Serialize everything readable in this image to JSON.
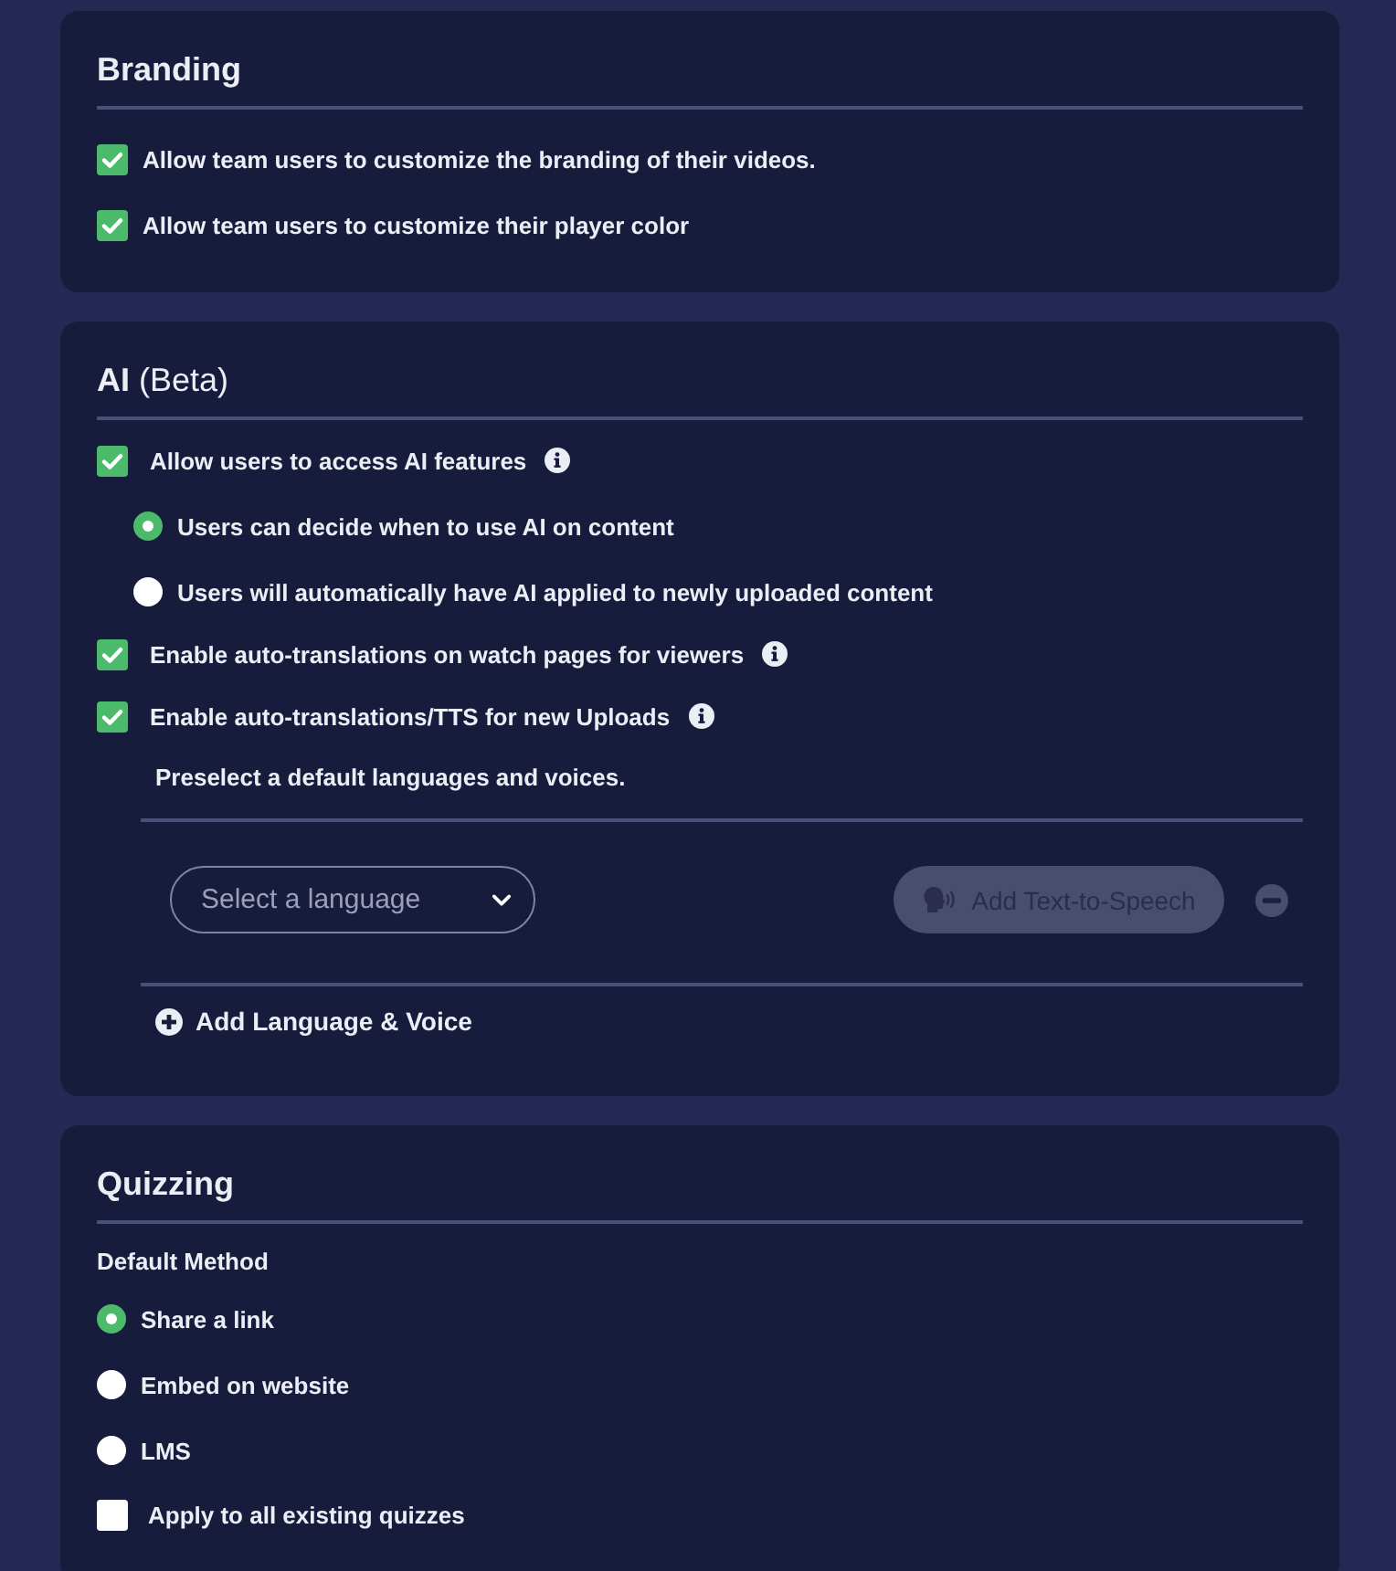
{
  "sections": [
    {
      "kind": "branding",
      "title": "Branding",
      "items": [
        {
          "kind": "checkbox",
          "label": "Allow team users to customize the branding of their videos.",
          "checked": true,
          "info": false
        },
        {
          "kind": "checkbox",
          "label": "Allow team users to customize their player color",
          "checked": true,
          "info": false
        }
      ]
    },
    {
      "kind": "ai",
      "title": "AI",
      "title_note": "(Beta)",
      "items": [
        {
          "kind": "checkbox",
          "label": "Allow users to access AI features",
          "checked": true,
          "info": true,
          "options": [
            {
              "label": "Users can decide when to use AI on content",
              "selected": true
            },
            {
              "label": "Users will automatically have AI applied to newly uploaded content",
              "selected": false
            }
          ]
        },
        {
          "kind": "checkbox",
          "label": "Enable auto-translations on watch pages for viewers",
          "checked": true,
          "info": true
        },
        {
          "kind": "checkbox",
          "label": "Enable auto-translations/TTS for new Uploads",
          "checked": true,
          "info": true
        },
        {
          "kind": "note",
          "label": "Preselect a default languages and voices."
        },
        {
          "kind": "language_row",
          "select": {
            "placeholder": "Select a language"
          },
          "tts_button": {
            "label": "Add Text-to-Speech",
            "disabled": true
          }
        },
        {
          "kind": "add_link",
          "label": "Add Language & Voice"
        }
      ]
    },
    {
      "kind": "quizzing",
      "title": "Quizzing",
      "items": [
        {
          "kind": "subheading",
          "label": "Default Method"
        },
        {
          "kind": "radio",
          "label": "Share a link",
          "selected": true
        },
        {
          "kind": "radio",
          "label": "Embed on website",
          "selected": false
        },
        {
          "kind": "radio",
          "label": "LMS",
          "selected": false
        },
        {
          "kind": "checkbox",
          "label": "Apply to all existing quizzes",
          "checked": false,
          "info": false
        }
      ]
    }
  ]
}
